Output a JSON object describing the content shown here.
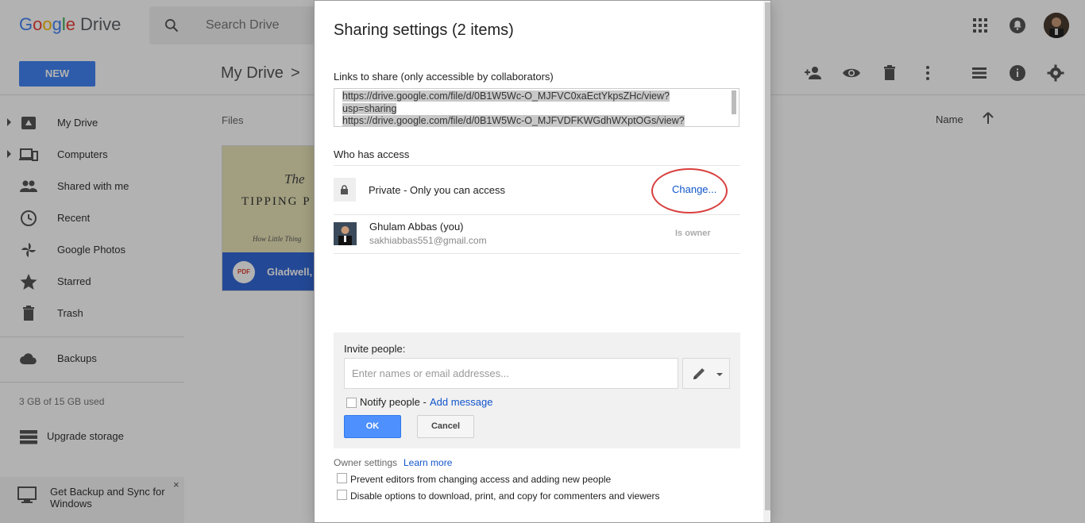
{
  "app": {
    "logo_google": "Google",
    "logo_drive": "Drive",
    "search_placeholder": "Search Drive",
    "new_button": "NEW",
    "breadcrumb": "My Drive",
    "breadcrumb_sep": ">",
    "sidebar": [
      {
        "label": "My Drive",
        "icon": "drive-icon"
      },
      {
        "label": "Computers",
        "icon": "computers-icon"
      },
      {
        "label": "Shared with me",
        "icon": "people-icon"
      },
      {
        "label": "Recent",
        "icon": "clock-icon"
      },
      {
        "label": "Google Photos",
        "icon": "photos-icon"
      },
      {
        "label": "Starred",
        "icon": "star-icon"
      },
      {
        "label": "Trash",
        "icon": "trash-icon"
      }
    ],
    "backups_label": "Backups",
    "storage_text": "3 GB of 15 GB used",
    "upgrade_label": "Upgrade storage",
    "backup_banner": "Get Backup and Sync for Windows",
    "backup_close": "×",
    "files_label": "Files",
    "name_label": "Name",
    "file_card": {
      "thumb_line1": "The",
      "thumb_line2": "TIPPING P",
      "thumb_line3": "How Little Thing",
      "type_badge": "PDF",
      "name": "Gladwell, M"
    }
  },
  "dialog": {
    "title": "Sharing settings (2 items)",
    "links_label": "Links to share (only accessible by collaborators)",
    "links": [
      "https://drive.google.com/file/d/0B1W5Wc-O_MJFVC0xaEctYkpsZHc/view?",
      "usp=sharing",
      "https://drive.google.com/file/d/0B1W5Wc-O_MJFVDFKWGdhWXptOGs/view?"
    ],
    "who_label": "Who has access",
    "access_text": "Private - Only you can access",
    "change_link": "Change...",
    "user_name": "Ghulam Abbas (you)",
    "user_email": "sakhiabbas551@gmail.com",
    "user_role": "Is owner",
    "invite_label": "Invite people:",
    "invite_placeholder": "Enter names or email addresses...",
    "notify_label": "Notify people -",
    "add_message": "Add message",
    "ok_button": "OK",
    "cancel_button": "Cancel",
    "owner_settings": "Owner settings",
    "learn_more": "Learn more",
    "option1": "Prevent editors from changing access and adding new people",
    "option2": "Disable options to download, print, and copy for commenters and viewers"
  },
  "colors": {
    "accent": "#4285f4",
    "link": "#1155cc",
    "highlight_circle": "#d93f3f"
  }
}
